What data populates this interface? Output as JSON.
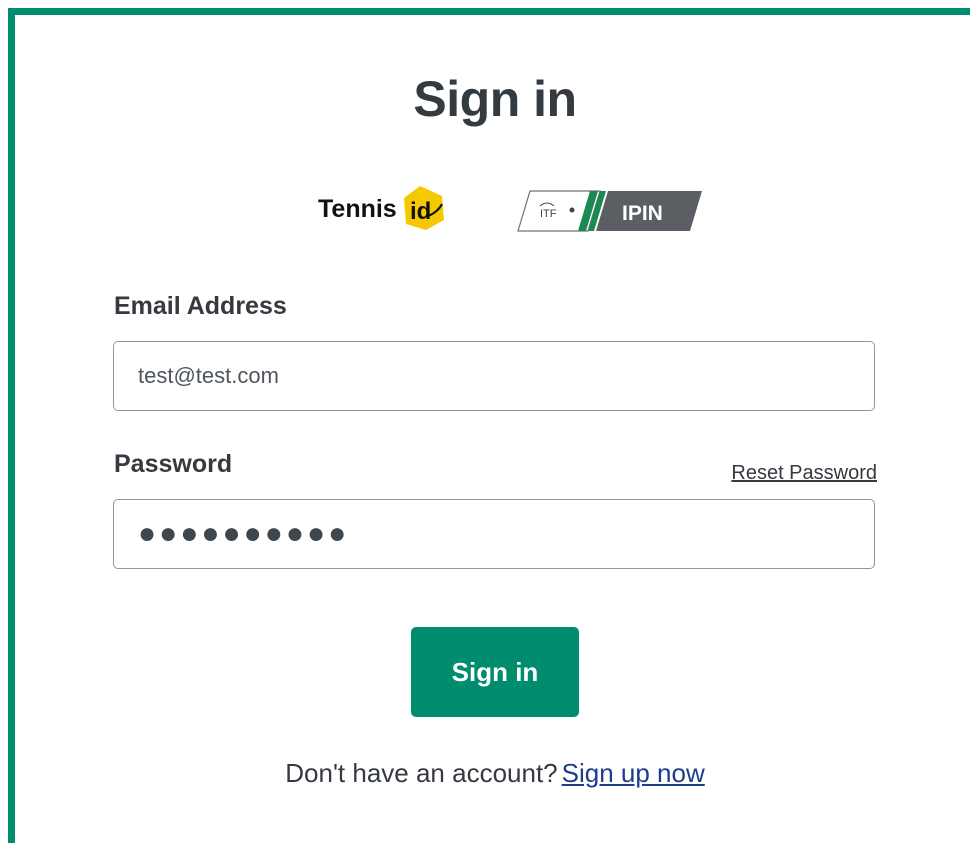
{
  "page": {
    "title": "Sign in"
  },
  "logos": {
    "tennisid": {
      "text": "Tennis",
      "badge": "id",
      "badge_color": "#f5c800"
    },
    "itf_ipin": {
      "itf_text": "ITF",
      "ipin_text": "IPIN",
      "stripe_color": "#1a8a52"
    }
  },
  "form": {
    "email_label": "Email Address",
    "email_value": "test@test.com",
    "password_label": "Password",
    "reset_password": "Reset Password",
    "password_value": "●●●●●●●●●●",
    "submit_label": "Sign in"
  },
  "signup": {
    "prompt": "Don't have an account?",
    "link": "Sign up now"
  },
  "colors": {
    "brand": "#008c6e",
    "text": "#333a40",
    "link": "#1d3d8a"
  }
}
